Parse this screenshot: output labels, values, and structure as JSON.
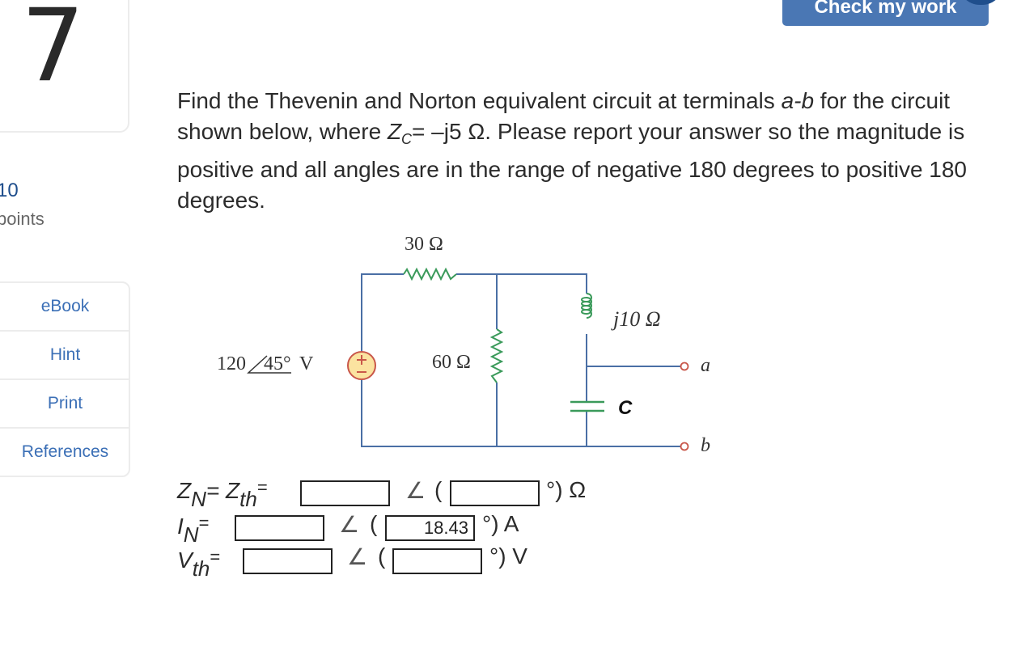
{
  "question": {
    "number": "7",
    "points_value": "10",
    "points_label": "points",
    "text_part1": "Find the Thevenin and Norton equivalent circuit at terminals ",
    "terminals": "a-b",
    "text_part2": " for the circuit shown below, where ",
    "zc_symbol": "Z",
    "zc_sub": "C",
    "zc_value": "= –j5 Ω",
    "text_part3": ". Please report your answer so the magnitude is positive and all angles are in the range of negative 180 degrees to positive 180 degrees."
  },
  "header": {
    "check_button_label": "Check my work"
  },
  "sidebar": {
    "items": [
      {
        "label": "eBook"
      },
      {
        "label": "Hint"
      },
      {
        "label": "Print"
      },
      {
        "label": "References"
      }
    ]
  },
  "circuit": {
    "r1_label": "30 Ω",
    "r2_label": "60 Ω",
    "inductor_label": "j10 Ω",
    "capacitor_label": "C",
    "source_label_mag": "120",
    "source_label_angle": "45°",
    "source_label_unit": " V",
    "terminal_a": "a",
    "terminal_b": "b",
    "wire_color": "#4a6fa5",
    "component_color": "#3a9a5a",
    "source_fill": "#fbe3a0",
    "source_stroke": "#c9574a"
  },
  "answers": {
    "angle_symbol": "∠",
    "open_paren": "(",
    "rows": [
      {
        "label_main": "Z",
        "label_sub": "N",
        "label_extra": "= Z",
        "label_extra_sub": "th",
        "eq": "=",
        "magnitude": "",
        "angle": "",
        "unit": "°) Ω"
      },
      {
        "label_main": "I",
        "label_sub": "N",
        "eq": "=",
        "magnitude": "",
        "angle": "18.43",
        "unit": "°) A"
      },
      {
        "label_main": "V",
        "label_sub": "th",
        "eq": "=",
        "magnitude": "",
        "angle": "",
        "unit": "°) V"
      }
    ]
  }
}
